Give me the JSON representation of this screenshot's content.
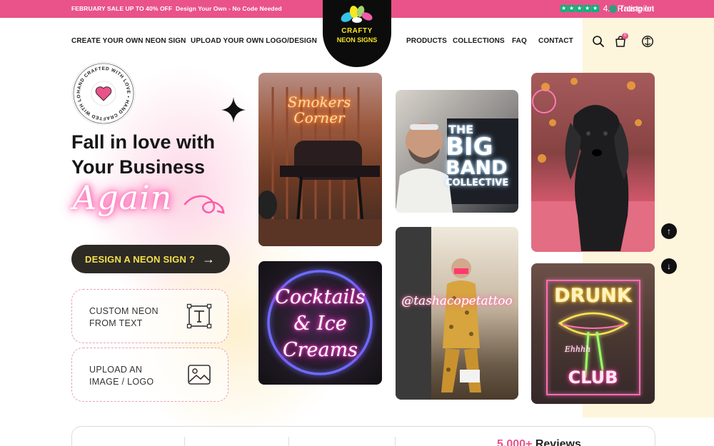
{
  "topbar": {
    "promo_sale": "FEBRUARY SALE UP TO 40% OFF",
    "promo_design": "Design Your Own - No Code Needed",
    "rating_text": "4.9 Rating on",
    "trustpilot": "Trustpilot",
    "star_count": 5,
    "color": "#e9538a"
  },
  "logo": {
    "line1": "CRAFTY",
    "line2": "NEON SIGNS"
  },
  "nav": {
    "create": "CREATE YOUR OWN NEON SIGN",
    "upload": "UPLOAD YOUR OWN LOGO/DESIGN",
    "products": "PRODUCTS",
    "collections": "COLLECTIONS",
    "faq": "FAQ",
    "contact": "CONTACT",
    "cart_count": "0",
    "icons": [
      "search-icon",
      "cart-icon",
      "currency-icon"
    ]
  },
  "badge": {
    "text": "HAND CRAFTED WITH LOVE • HAND CRAFTED WITH LOVE •"
  },
  "hero": {
    "line1": "Fall in love with",
    "line2": "Your Business",
    "script": "Again",
    "cta": "DESIGN A NEON SIGN ?"
  },
  "options": [
    {
      "line1": "CUSTOM NEON",
      "line2": "FROM TEXT",
      "icon": "text-icon"
    },
    {
      "line1": "UPLOAD AN",
      "line2": "IMAGE / LOGO",
      "icon": "image-icon"
    }
  ],
  "gallery": {
    "smokers": [
      "Smokers",
      "Corner"
    ],
    "bigband": [
      "THE",
      "BIG",
      "BAND",
      "COLLECTIVE"
    ],
    "cocktails": [
      "Cocktails",
      "& Ice",
      "Creams"
    ],
    "tattoo": "@tashacopetattoo",
    "drunk": [
      "DRUNK",
      "Ehhhh",
      "CLUB"
    ]
  },
  "bottom": {
    "reviews_count": "5,000+",
    "reviews_label": "Reviews"
  },
  "colors": {
    "accent": "#e9538a",
    "cta_bg": "#2d2a26",
    "cta_text": "#f4e14c",
    "cream": "#fdf5dc"
  }
}
